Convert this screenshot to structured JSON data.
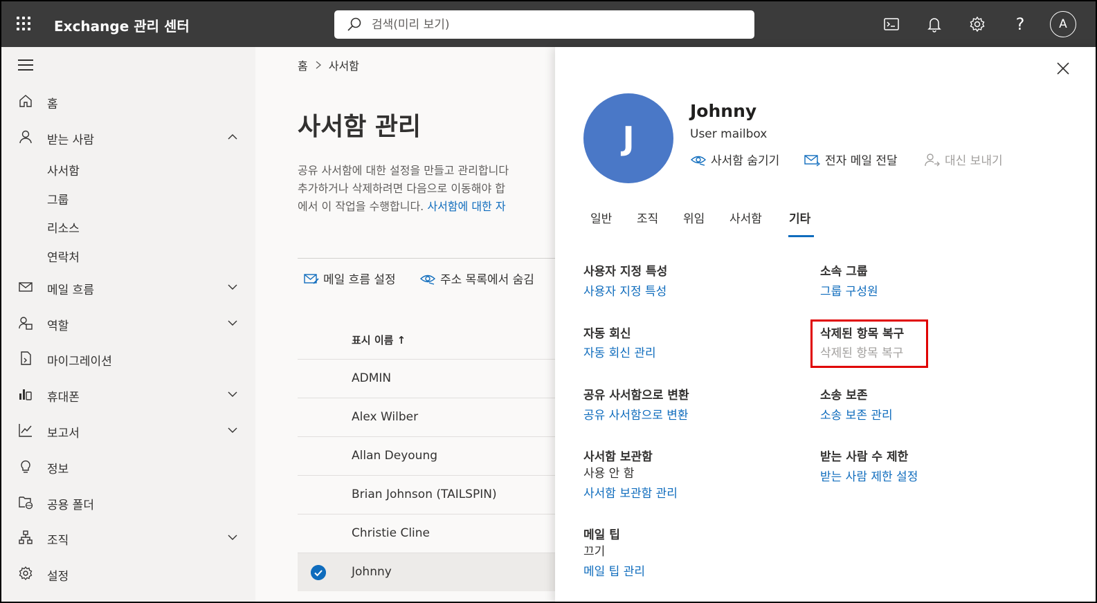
{
  "topbar": {
    "app_title": "Exchange 관리 센터",
    "search_placeholder": "검색(미리 보기)",
    "avatar_initial": "A"
  },
  "nav": {
    "home": "홈",
    "recipients": "받는 사람",
    "recipients_sub": [
      "사서함",
      "그룹",
      "리소스",
      "연락처"
    ],
    "mail_flow": "메일 흐름",
    "roles": "역할",
    "migration": "마이그레이션",
    "mobile": "휴대폰",
    "reports": "보고서",
    "insights": "정보",
    "public_folders": "공용 폴더",
    "organization": "조직",
    "settings": "설정"
  },
  "main": {
    "breadcrumb_home": "홈",
    "breadcrumb_current": "사서함",
    "title": "사서함 관리",
    "desc_line1": "공유 사서함에 대한 설정을 만들고 관리합니다",
    "desc_line2": "추가하거나 삭제하려면 다음으로 이동해야 합",
    "desc_line3": "에서 이 작업을 수행합니다. ",
    "desc_link": "사서함에 대한 자",
    "cmd_mail_flow": "메일 흐름 설정",
    "cmd_hide": "주소 목록에서 숨김",
    "col_display_name": "표시 이름 ↑",
    "rows": [
      "ADMIN",
      "Alex Wilber",
      "Allan Deyoung",
      "Brian Johnson (TAILSPIN)",
      "Christie Cline",
      "Johnny"
    ]
  },
  "panel": {
    "avatar_initial": "J",
    "user_name": "Johnny",
    "user_type": "User mailbox",
    "action_hide": "사서함 숨기기",
    "action_forward": "전자 메일 전달",
    "action_send_on_behalf": "대신 보내기",
    "tabs": [
      "일반",
      "조직",
      "위임",
      "사서함",
      "기타"
    ],
    "custom_attrs_title": "사용자 지정 특성",
    "custom_attrs_link": "사용자 지정 특성",
    "member_of_title": "소속 그룹",
    "member_of_link": "그룹 구성원",
    "auto_reply_title": "자동 회신",
    "auto_reply_link": "자동 회신 관리",
    "recover_title": "삭제된 항목 복구",
    "recover_link": "삭제된 항목 복구",
    "convert_title": "공유 사서함으로 변환",
    "convert_link": "공유 사서함으로 변환",
    "litigation_title": "소송 보존",
    "litigation_link": "소송 보존 관리",
    "archive_title": "사서함 보관함",
    "archive_status": "사용 안 함",
    "archive_link": "사서함 보관함 관리",
    "recipient_limit_title": "받는 사람 수 제한",
    "recipient_limit_link": "받는 사람 제한 설정",
    "mailtip_title": "메일 팁",
    "mailtip_status": "끄기",
    "mailtip_link": "메일 팁 관리"
  },
  "colors": {
    "topbar": "#3b3b3b",
    "accent": "#0f6cbd",
    "avatar": "#4a78c7",
    "highlight": "#e00000"
  }
}
